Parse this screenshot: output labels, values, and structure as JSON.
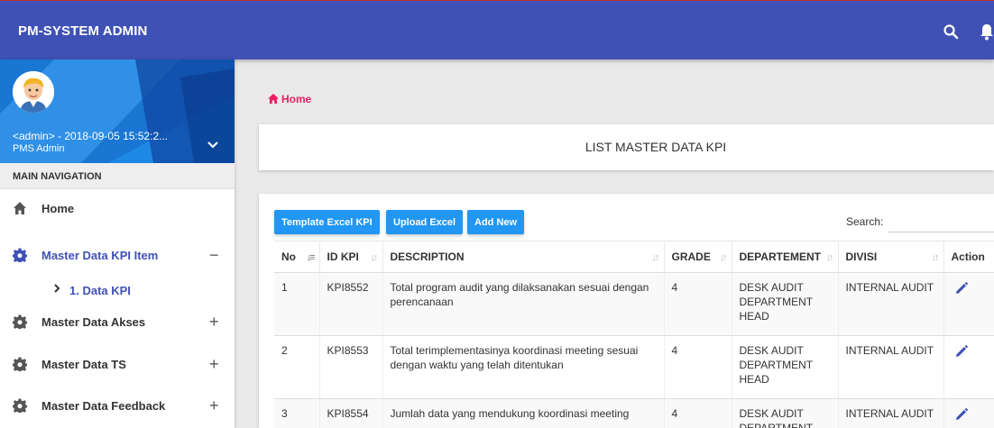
{
  "app": {
    "title": "PM-SYSTEM ADMIN",
    "search_icon": "search-icon",
    "bell_icon": "bell-icon"
  },
  "colors": {
    "topbar": "#3f51b5",
    "accent": "#e91e63",
    "button": "#2196f3",
    "sidebar_panel": "#1565c0"
  },
  "user": {
    "name": "<admin> - 2018-09-05 15:52:2...",
    "role": "PMS Admin"
  },
  "sidebar": {
    "header": "MAIN NAVIGATION",
    "items": [
      {
        "label": "Home",
        "icon": "home-icon",
        "sign": ""
      },
      {
        "label": "Master Data KPI Item",
        "icon": "gear-icon",
        "sign": "−",
        "active": true
      },
      {
        "label": "1. Data KPI",
        "icon": "chevron-right-icon",
        "sub": true
      },
      {
        "label": "Master Data Akses",
        "icon": "gear-icon",
        "sign": "+"
      },
      {
        "label": "Master Data TS",
        "icon": "gear-icon",
        "sign": "+"
      },
      {
        "label": "Master Data Feedback",
        "icon": "gear-icon",
        "sign": "+"
      }
    ]
  },
  "breadcrumb": {
    "label": "Home",
    "icon": "home-icon"
  },
  "page": {
    "title": "LIST MASTER DATA KPI"
  },
  "toolbar": {
    "template_label": "Template Excel KPI",
    "upload_label": "Upload Excel",
    "add_label": "Add New",
    "search_label": "Search:",
    "search_value": ""
  },
  "table": {
    "headers": [
      "No",
      "ID KPI",
      "DESCRIPTION",
      "GRADE",
      "DEPARTEMENT",
      "DIVISI",
      "Action"
    ],
    "rows": [
      {
        "no": "1",
        "id": "KPI8552",
        "description": "Total program audit yang dilaksanakan sesuai dengan perencanaan",
        "grade": "4",
        "departement": "DESK AUDIT DEPARTMENT HEAD",
        "divisi": "INTERNAL AUDIT"
      },
      {
        "no": "2",
        "id": "KPI8553",
        "description": "Total terimplementasinya koordinasi meeting sesuai dengan waktu yang telah ditentukan",
        "grade": "4",
        "departement": "DESK AUDIT DEPARTMENT HEAD",
        "divisi": "INTERNAL AUDIT"
      },
      {
        "no": "3",
        "id": "KPI8554",
        "description": "Jumlah data yang mendukung koordinasi meeting",
        "grade": "4",
        "departement": "DESK AUDIT DEPARTMENT",
        "divisi": "INTERNAL AUDIT"
      }
    ]
  }
}
